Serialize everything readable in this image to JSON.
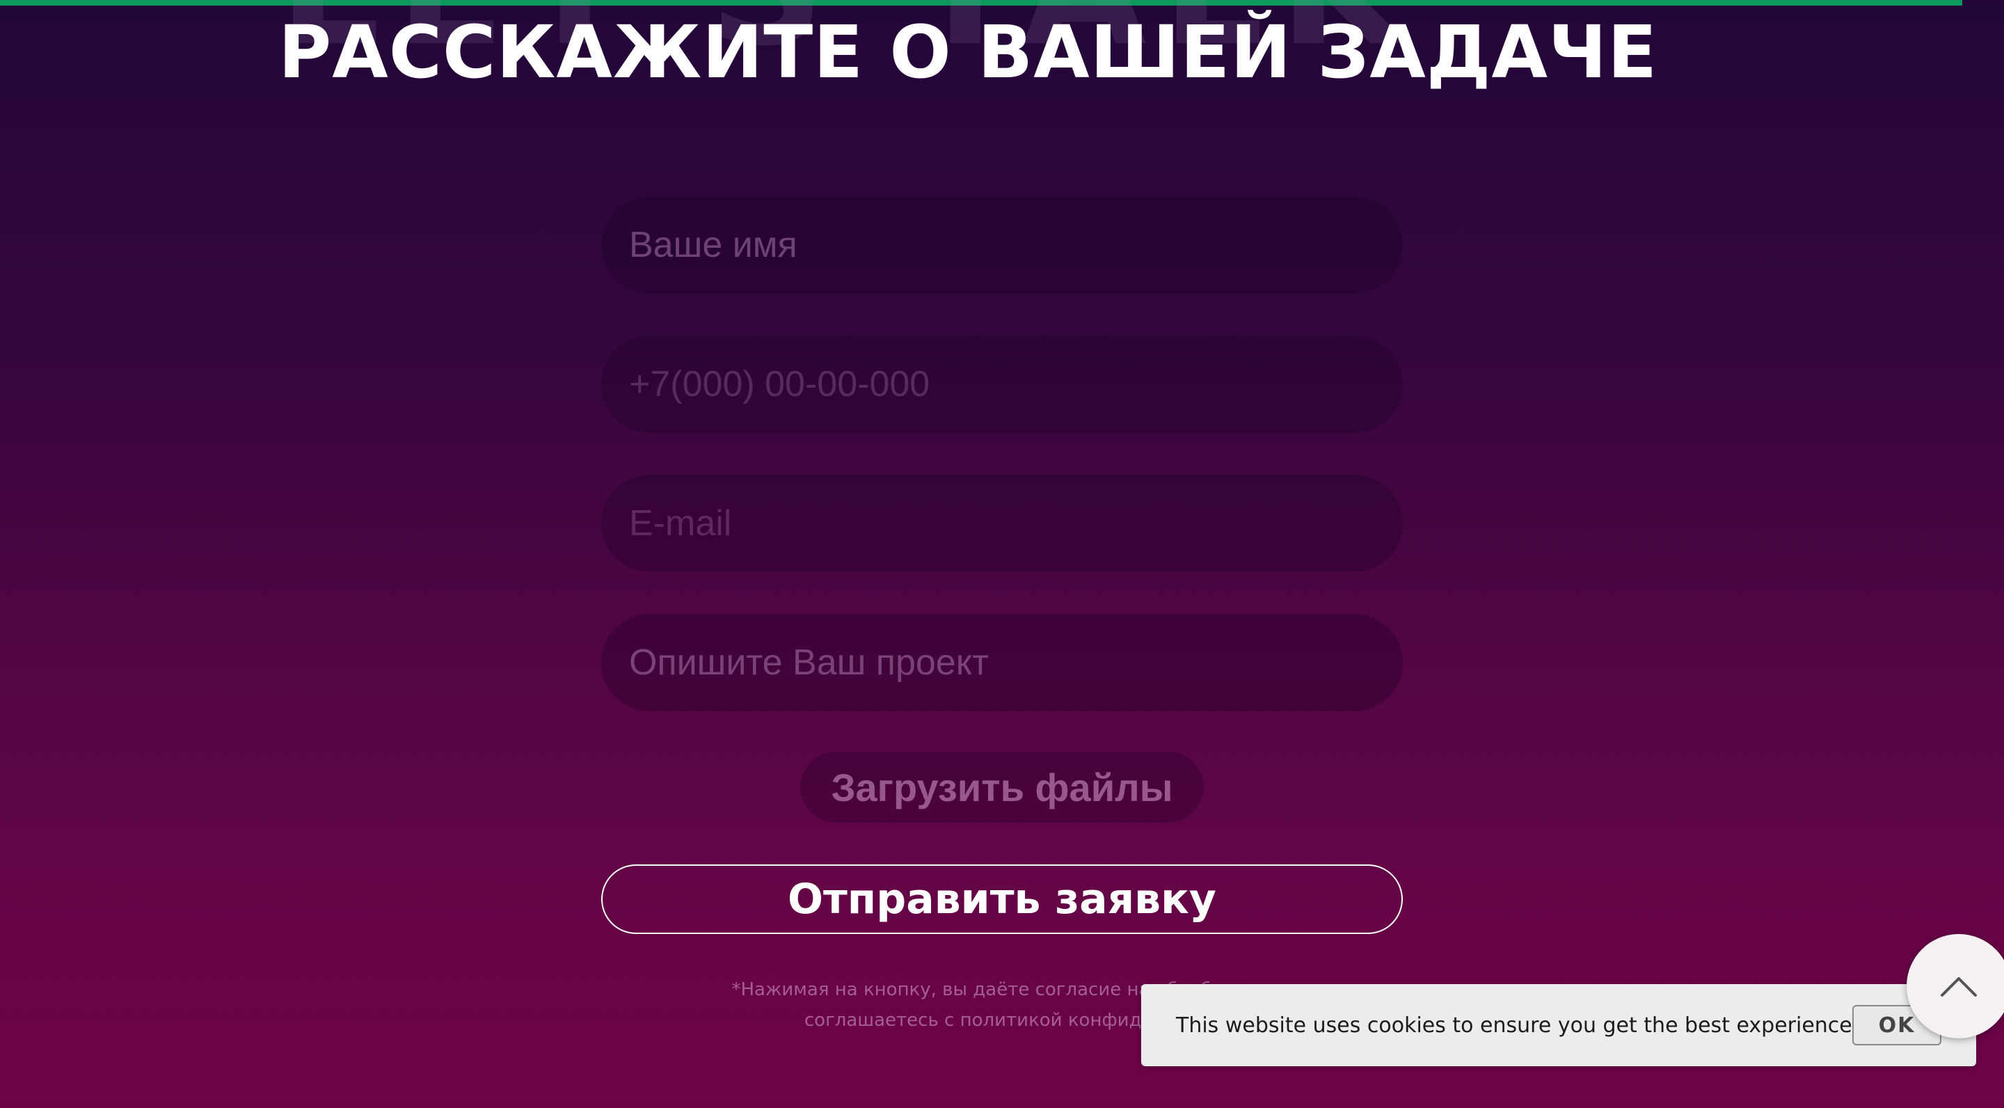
{
  "colors": {
    "accent_bar": "#0b9a5c",
    "background_top": "#220638",
    "background_bottom": "#6f0246",
    "title": "#ffffff",
    "cookie_bar": "#ececec"
  },
  "background_word": "LET'S TALK",
  "section": {
    "title": "РАССКАЖИТЕ О ВАШЕЙ ЗАДАЧЕ"
  },
  "form": {
    "name_placeholder": "Ваше имя",
    "phone_placeholder": "+7(000) 00-00-000",
    "email_placeholder": "E-mail",
    "project_placeholder": "Опишите Ваш проект",
    "upload_label": "Загрузить файлы",
    "submit_label": "Отправить заявку",
    "consent_line1": "*Нажимая на кнопку, вы даёте согласие на обработку п",
    "consent_line2": "соглашаетесь с политикой конфиденциа"
  },
  "cookie": {
    "message": "This website uses cookies to ensure you get the best experience",
    "ok_label": "OK"
  },
  "icons": {
    "scroll_top": "chevron-up-icon"
  }
}
